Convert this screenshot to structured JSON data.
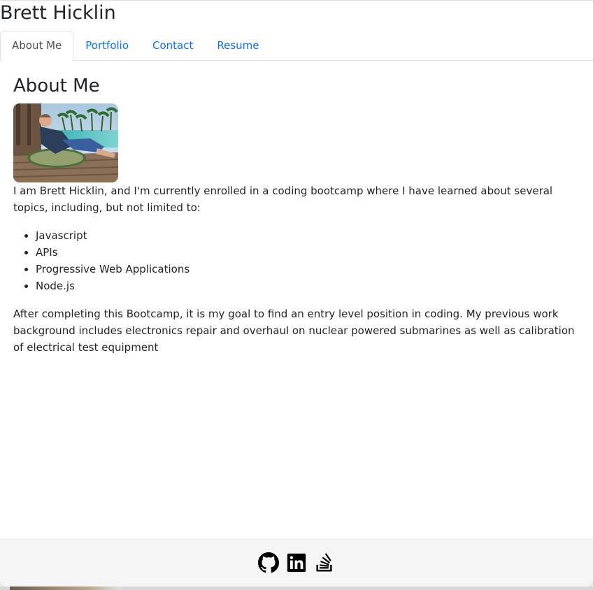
{
  "header": {
    "site_title": "Brett Hicklin"
  },
  "tabs": [
    {
      "label": "About Me",
      "active": true
    },
    {
      "label": "Portfolio",
      "active": false
    },
    {
      "label": "Contact",
      "active": false
    },
    {
      "label": "Resume",
      "active": false
    }
  ],
  "about": {
    "heading": "About Me",
    "intro": "I am Brett Hicklin, and I'm currently enrolled in a coding bootcamp where I have learned about several topics, including, but not limited to:",
    "topics": [
      "Javascript",
      "APIs",
      "Progressive Web Applications",
      "Node.js"
    ],
    "goal": "After completing this Bootcamp, it is my goal to find an entry level position in coding. My previous work background includes electronics repair and overhaul on nuclear powered submarines as well as calibration of electrical test equipment"
  },
  "footer": {
    "icons": [
      "github-icon",
      "linkedin-icon",
      "stack-overflow-icon"
    ]
  },
  "colors": {
    "link": "#0d6efd",
    "text": "#212529",
    "footer_bg": "#f5f5f5"
  }
}
